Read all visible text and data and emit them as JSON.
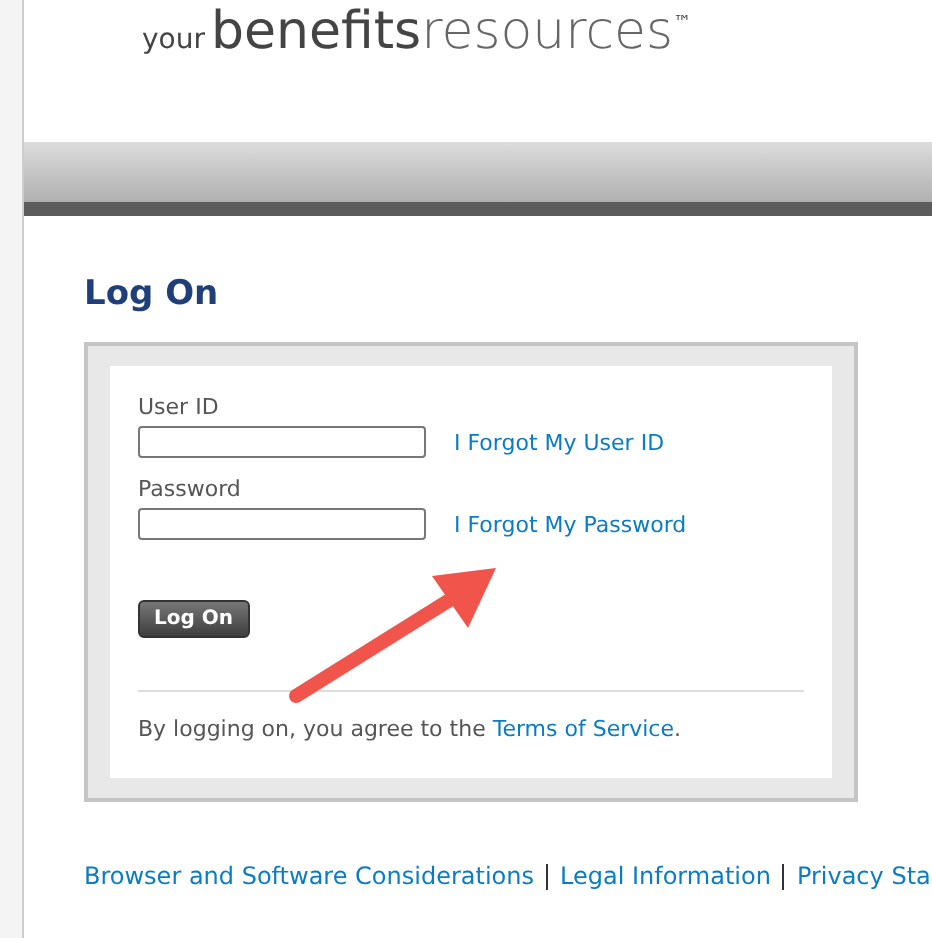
{
  "logo": {
    "prefix": "your",
    "main": "benefits",
    "suffix": "resources",
    "mark": "™"
  },
  "heading": "Log On",
  "fields": [
    {
      "label": "User ID",
      "link": "I Forgot My User ID"
    },
    {
      "label": "Password",
      "link": "I Forgot My Password"
    }
  ],
  "button": "Log On",
  "agreement": {
    "text": "By logging on, you agree to the ",
    "link": "Terms of Service",
    "end": "."
  },
  "footer_links": [
    "Browser and Software Considerations",
    "Legal Information",
    "Privacy Sta"
  ]
}
